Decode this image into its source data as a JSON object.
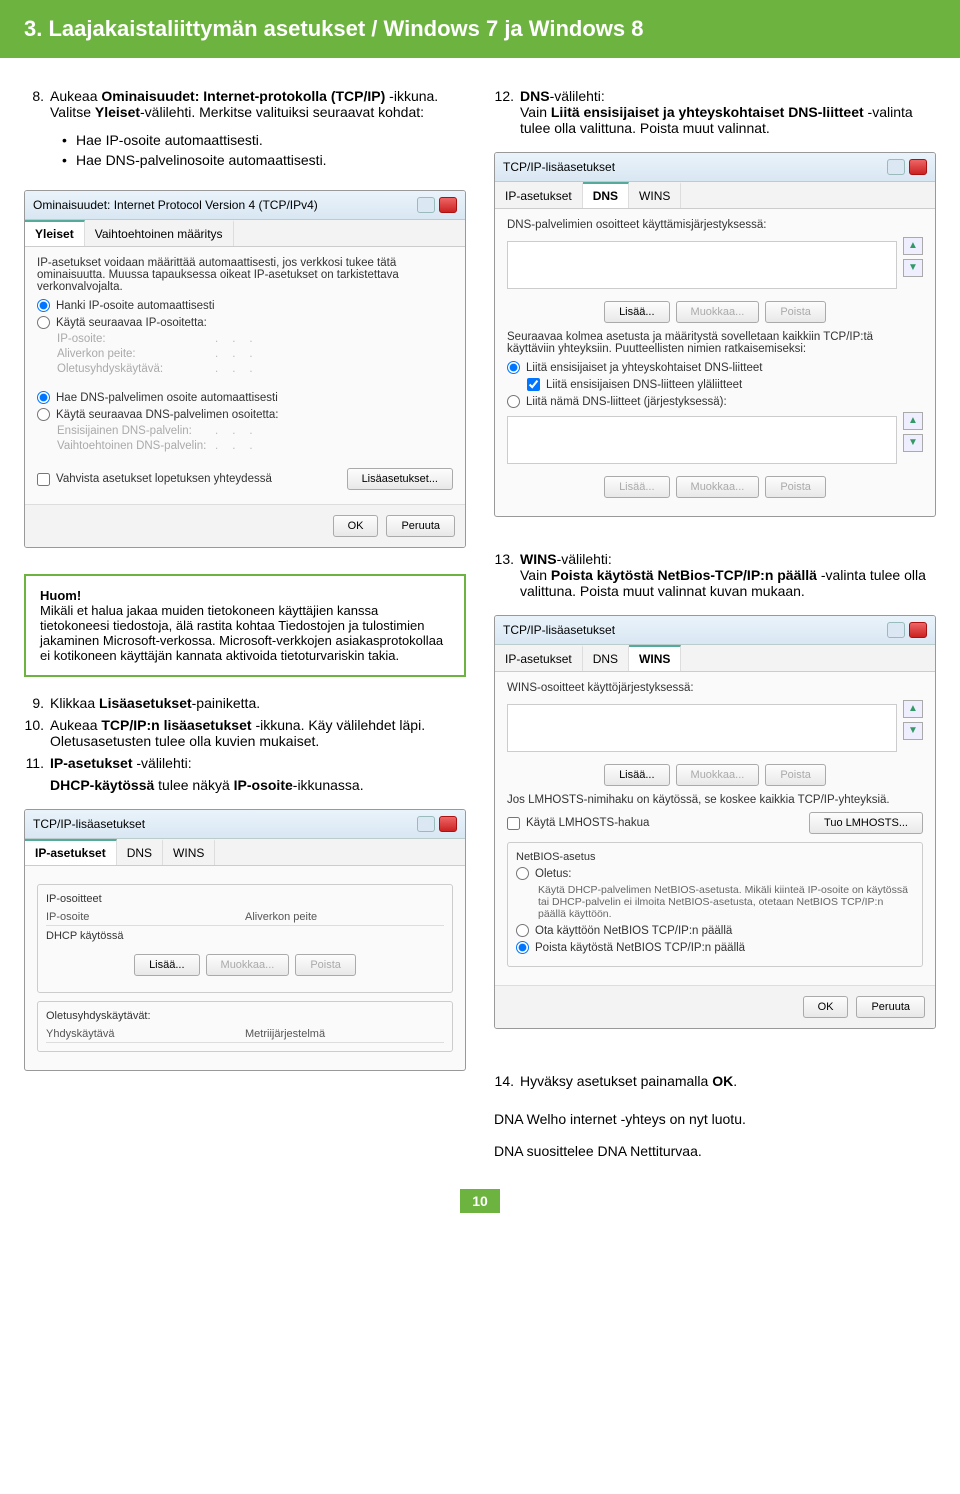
{
  "header": {
    "title": "3. Laajakaistaliittymän asetukset / Windows 7 ja Windows 8"
  },
  "left": {
    "step8": {
      "num": "8.",
      "text_a": "Aukeaa ",
      "text_b": "Ominaisuudet: Internet-protokolla (TCP/IP)",
      "text_c": " -ikkuna. Valitse ",
      "text_d": "Yleiset",
      "text_e": "-välilehti. Merkitse valituiksi seuraavat kohdat:"
    },
    "bullets8": [
      "Hae IP-osoite automaattisesti.",
      "Hae DNS-palvelinosoite automaattisesti."
    ],
    "shot1": {
      "title": "Ominaisuudet: Internet Protocol Version 4 (TCP/IPv4)",
      "tab1": "Yleiset",
      "tab2": "Vaihtoehtoinen määritys",
      "intro": "IP-asetukset voidaan määrittää automaattisesti, jos verkkosi tukee tätä ominaisuutta. Muussa tapauksessa oikeat IP-asetukset on tarkistettava verkonvalvojalta.",
      "r1": "Hanki IP-osoite automaattisesti",
      "r2": "Käytä seuraavaa IP-osoitetta:",
      "f1": "IP-osoite:",
      "f2": "Aliverkon peite:",
      "f3": "Oletusyhdyskäytävä:",
      "r3": "Hae DNS-palvelimen osoite automaattisesti",
      "r4": "Käytä seuraavaa DNS-palvelimen osoitetta:",
      "f4": "Ensisijainen DNS-palvelin:",
      "f5": "Vaihtoehtoinen DNS-palvelin:",
      "chk": "Vahvista asetukset lopetuksen yhteydessä",
      "adv": "Lisäasetukset...",
      "ok": "OK",
      "cancel": "Peruuta"
    },
    "note": {
      "head": "Huom!",
      "body": "Mikäli et halua jakaa muiden tietokoneen käyttäjien kanssa tietokoneesi tiedostoja, älä rastita kohtaa Tiedostojen ja tulostimien jakaminen Microsoft-verkossa. Microsoft-verkkojen asiakasprotokollaa ei kotikoneen käyttäjän kannata aktivoida tietoturvariskin takia."
    },
    "step9": {
      "num": "9.",
      "text_a": "Klikkaa ",
      "text_b": "Lisäasetukset",
      "text_c": "-painiketta."
    },
    "step10": {
      "num": "10.",
      "text_a": "Aukeaa ",
      "text_b": "TCP/IP:n lisäasetukset ",
      "text_c": "-ikkuna. Käy välilehdet läpi. Oletusasetusten tulee olla kuvien mukaiset."
    },
    "step11": {
      "num": "11.",
      "text_a": "IP-asetukset ",
      "text_b": "-välilehti:"
    },
    "step11b": {
      "text_a": "DHCP-käytössä ",
      "text_b": "tulee näkyä ",
      "text_c": "IP-osoite",
      "text_d": "-ikkunassa."
    },
    "shot2": {
      "title": "TCP/IP-lisäasetukset",
      "tab1": "IP-asetukset",
      "tab2": "DNS",
      "tab3": "WINS",
      "box1": "IP-osoitteet",
      "col1": "IP-osoite",
      "col2": "Aliverkon peite",
      "val": "DHCP käytössä",
      "b1": "Lisää...",
      "b2": "Muokkaa...",
      "b3": "Poista",
      "box2": "Oletusyhdyskäytävät:",
      "col3": "Yhdyskäytävä",
      "col4": "Metriijärjestelmä"
    }
  },
  "right": {
    "step12": {
      "num": "12.",
      "text_a": "DNS",
      "text_b": "-välilehti:",
      "text_c": "Vain ",
      "text_d": "Liitä ensisijaiset ja yhteyskohtaiset DNS-liitteet ",
      "text_e": "-valinta tulee olla valittuna. Poista muut valinnat."
    },
    "shot3": {
      "title": "TCP/IP-lisäasetukset",
      "tab1": "IP-asetukset",
      "tab2": "DNS",
      "tab3": "WINS",
      "line1": "DNS-palvelimien osoitteet käyttämisjärjestyksessä:",
      "b1": "Lisää...",
      "b2": "Muokkaa...",
      "b3": "Poista",
      "line2": "Seuraavaa kolmea asetusta ja määritystä sovelletaan kaikkiin TCP/IP:tä käyttäviin yhteyksiin. Puutteellisten nimien ratkaisemiseksi:",
      "r1": "Liitä ensisijaiset ja yhteyskohtaiset DNS-liitteet",
      "chk1": "Liitä ensisijaisen DNS-liitteen yläliitteet",
      "r2": "Liitä nämä DNS-liitteet (järjestyksessä):"
    },
    "step13": {
      "num": "13.",
      "text_a": "WINS",
      "text_b": "-välilehti:",
      "text_c": "Vain ",
      "text_d": "Poista käytöstä NetBios-TCP/IP:n päällä",
      "text_e": " -valinta tulee olla valittuna. Poista muut valinnat kuvan mukaan."
    },
    "shot4": {
      "title": "TCP/IP-lisäasetukset",
      "tab1": "IP-asetukset",
      "tab2": "DNS",
      "tab3": "WINS",
      "line1": "WINS-osoitteet käyttöjärjestyksessä:",
      "b1": "Lisää...",
      "b2": "Muokkaa...",
      "b3": "Poista",
      "line2": "Jos LMHOSTS-nimihaku on käytössä, se koskee kaikkia TCP/IP-yhteyksiä.",
      "chk1": "Käytä LMHOSTS-hakua",
      "imp": "Tuo LMHOSTS...",
      "box": "NetBIOS-asetus",
      "r1": "Oletus:",
      "r1desc": "Käytä DHCP-palvelimen NetBIOS-asetusta. Mikäli kiinteä IP-osoite on käytössä tai DHCP-palvelin ei ilmoita NetBIOS-asetusta, otetaan NetBIOS TCP/IP:n päällä käyttöön.",
      "r2": "Ota käyttöön NetBIOS TCP/IP:n päällä",
      "r3": "Poista käytöstä NetBIOS TCP/IP:n päällä",
      "ok": "OK",
      "cancel": "Peruuta"
    },
    "step14": {
      "num": "14.",
      "text_a": "Hyväksy asetukset painamalla ",
      "text_b": "OK",
      "text_c": "."
    },
    "closing1": "DNA Welho internet -yhteys on nyt luotu.",
    "closing2": "DNA suosittelee DNA Nettiturvaa."
  },
  "pagenum": "10"
}
